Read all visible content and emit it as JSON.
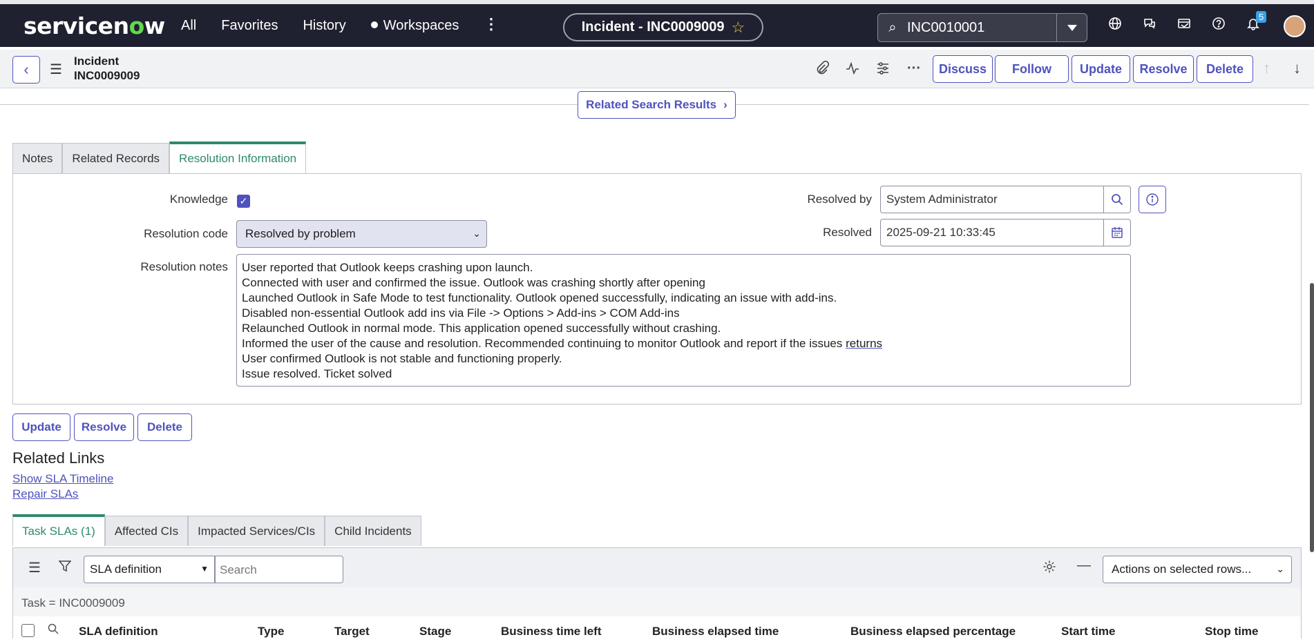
{
  "nav": {
    "logo_prefix": "servicen",
    "logo_o": "o",
    "logo_suffix": "w",
    "links": [
      "All",
      "Favorites",
      "History",
      "Workspaces"
    ],
    "record_pill": "Incident - INC0009009",
    "search_value": "INC0010001",
    "notification_count": "5"
  },
  "header": {
    "line1": "Incident",
    "line2": "INC0009009",
    "buttons": {
      "discuss": "Discuss",
      "follow": "Follow",
      "update": "Update",
      "resolve": "Resolve",
      "delete": "Delete"
    }
  },
  "related_search": "Related Search Results",
  "form_tabs": [
    "Notes",
    "Related Records",
    "Resolution Information"
  ],
  "resolution": {
    "knowledge_label": "Knowledge",
    "knowledge_checked": true,
    "code_label": "Resolution code",
    "code_value": "Resolved by problem",
    "notes_label": "Resolution notes",
    "notes_lines": [
      "User reported that Outlook keeps crashing upon launch.",
      "Connected with user and confirmed the issue. Outlook was crashing shortly after opening",
      "Launched Outlook in Safe Mode to test functionality. Outlook opened successfully, indicating an issue with add-ins.",
      "Disabled non-essential Outlook add ins via File -> Options > Add-ins > COM Add-ins",
      "Relaunched Outlook in normal mode. This application opened successfully without crashing.",
      "Informed the user of the cause and resolution. Recommended continuing to monitor Outlook and report if the issues",
      "User confirmed Outlook is not stable and functioning properly.",
      "Issue resolved. Ticket solved"
    ],
    "notes_line6_tail": "returns",
    "resolved_by_label": "Resolved by",
    "resolved_by_value": "System Administrator",
    "resolved_label": "Resolved",
    "resolved_value": "2025-09-21 10:33:45"
  },
  "actions": {
    "update": "Update",
    "resolve": "Resolve",
    "delete": "Delete"
  },
  "related_links": {
    "title": "Related Links",
    "links": [
      "Show SLA Timeline",
      "Repair SLAs"
    ]
  },
  "list_tabs": [
    "Task SLAs (1)",
    "Affected CIs",
    "Impacted Services/CIs",
    "Child Incidents"
  ],
  "list": {
    "search_field": "SLA definition",
    "search_placeholder": "Search",
    "actions_select": "Actions on selected rows...",
    "filter": "Task = INC0009009",
    "columns": [
      "SLA definition",
      "Type",
      "Target",
      "Stage",
      "Business time left",
      "Business elapsed time",
      "Business elapsed percentage",
      "Start time",
      "Stop time"
    ]
  },
  "colors": {
    "accent": "#4f52bd",
    "nav_bg": "#1f2130",
    "tab_active": "#2f8a6a"
  }
}
